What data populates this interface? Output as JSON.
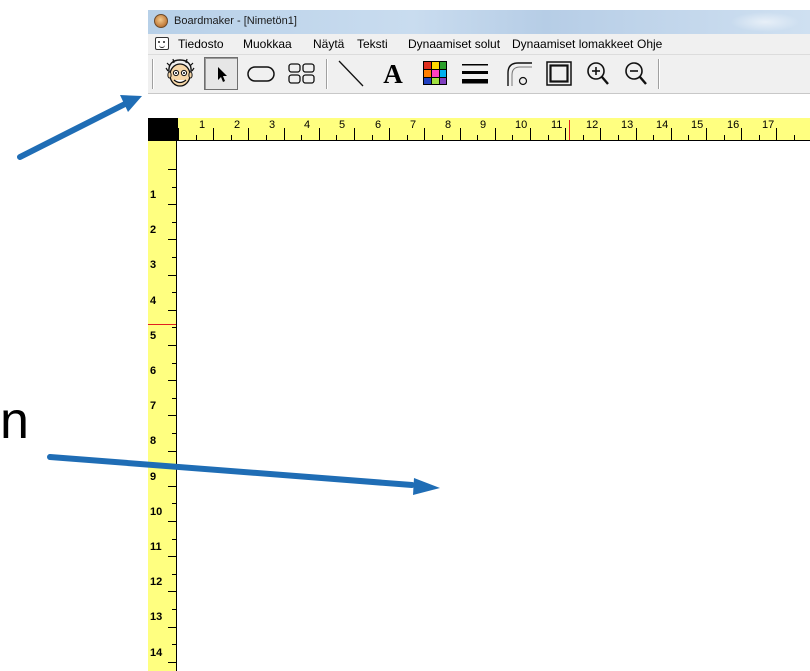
{
  "window": {
    "title": "Boardmaker - [Nimetön1]"
  },
  "menu": {
    "items": [
      "Tiedosto",
      "Muokkaa",
      "Näytä",
      "Teksti",
      "Dynaamiset solut",
      "Dynaamiset lomakkeet",
      "Ohje"
    ]
  },
  "toolbar": {
    "tools": [
      "symbol-finder",
      "pointer",
      "button",
      "cells",
      "line",
      "text",
      "color",
      "line-thickness",
      "corner-radius",
      "border",
      "zoom-in",
      "zoom-out"
    ]
  },
  "ruler": {
    "horizontal": [
      "1",
      "2",
      "3",
      "4",
      "5",
      "6",
      "7",
      "8",
      "9",
      "10",
      "11",
      "12",
      "13",
      "14",
      "15",
      "16",
      "17"
    ],
    "vertical": [
      "1",
      "2",
      "3",
      "4",
      "5",
      "6",
      "7",
      "8",
      "9",
      "10",
      "11",
      "12",
      "13",
      "14"
    ]
  },
  "annotation": {
    "cutoff_text": "n",
    "arrow_color": "#1f6db5"
  },
  "colors": {
    "ruler": "#ffff80",
    "title_bar": "#c9dcef",
    "marker": "#e02020"
  }
}
